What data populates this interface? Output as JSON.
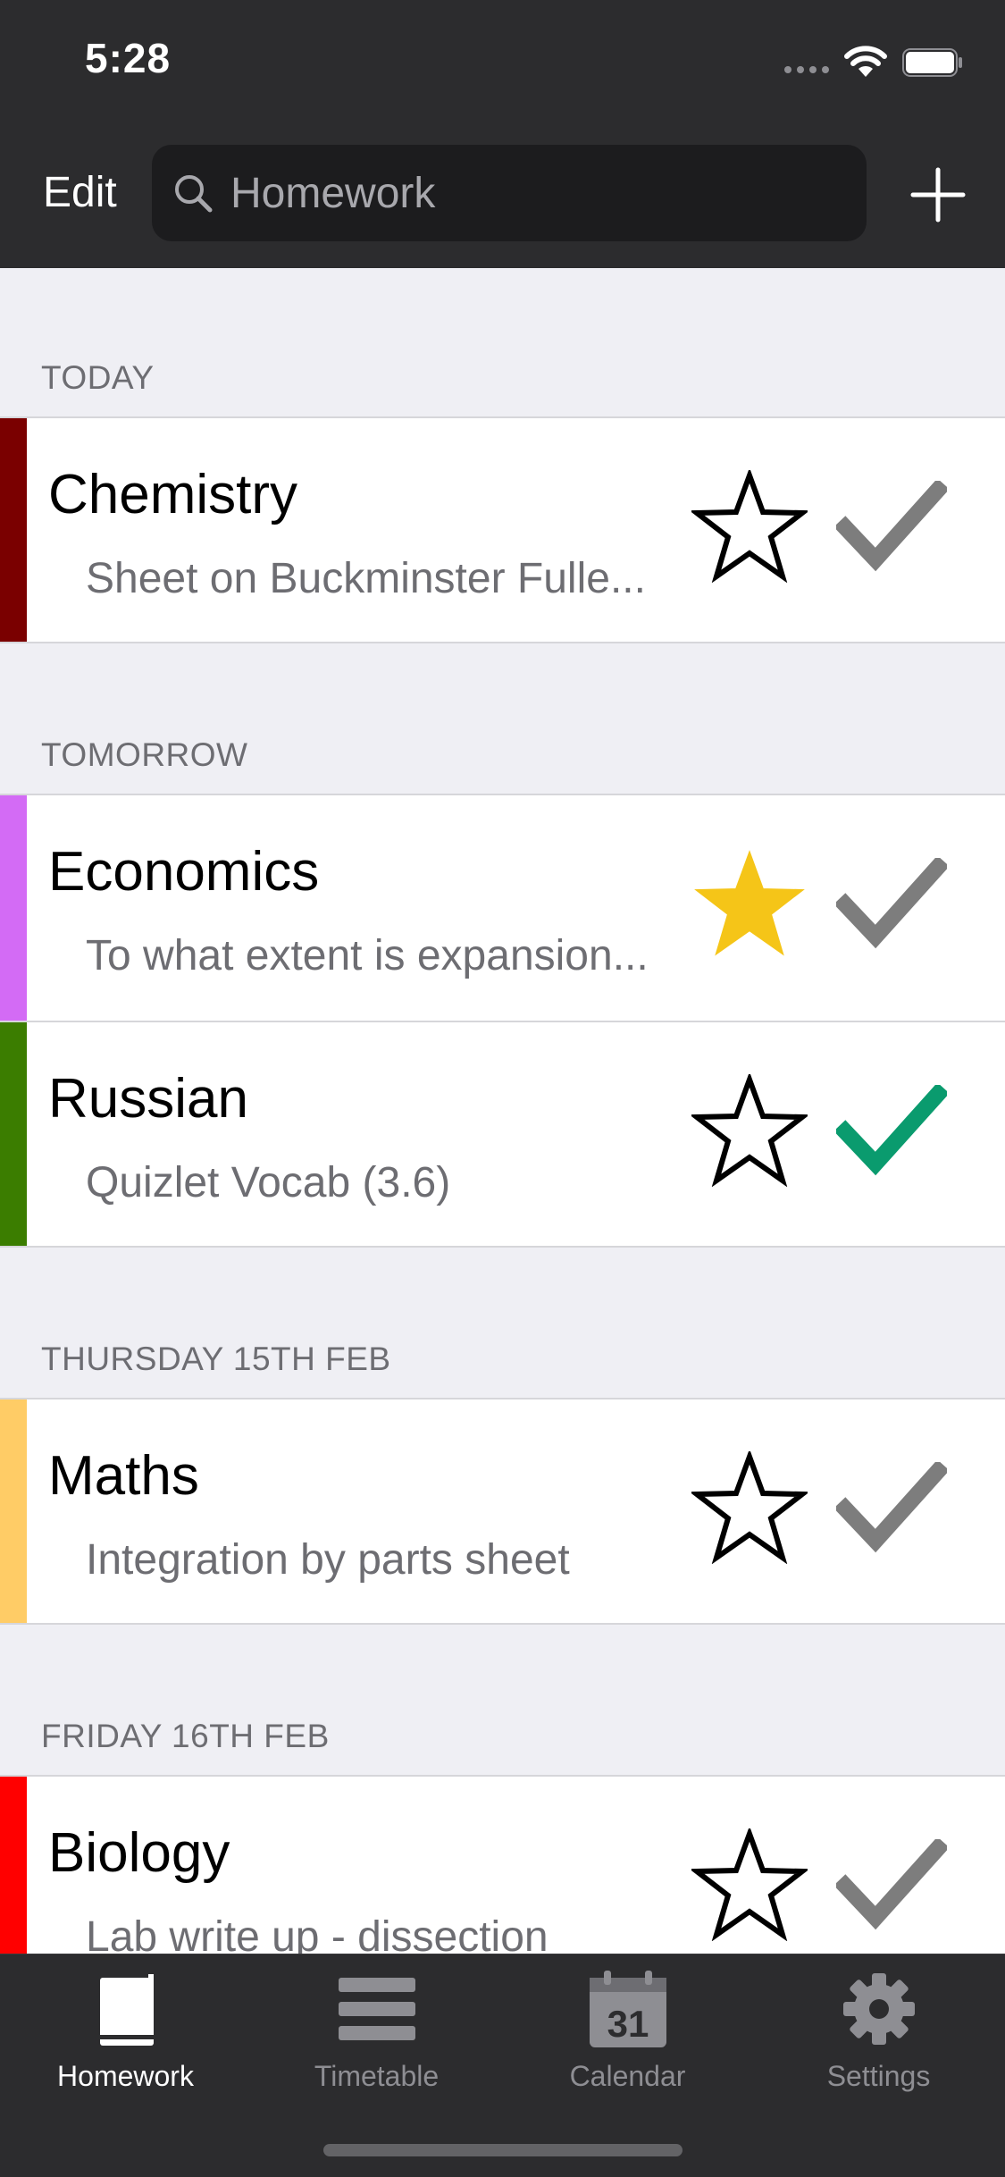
{
  "status_bar": {
    "time": "5:28"
  },
  "nav": {
    "edit_label": "Edit",
    "search_placeholder": "Homework"
  },
  "sections": [
    {
      "header": "TODAY",
      "items": [
        {
          "title": "Chemistry",
          "subtitle": "Sheet on Buckminster Fulle...",
          "color": "#7a0000",
          "starred": false,
          "completed": false
        }
      ]
    },
    {
      "header": "TOMORROW",
      "items": [
        {
          "title": "Economics",
          "subtitle": "To what extent is expansion...",
          "color": "#d36bf5",
          "starred": true,
          "completed": false
        },
        {
          "title": "Russian",
          "subtitle": "Quizlet Vocab (3.6)",
          "color": "#3b7d00",
          "starred": false,
          "completed": true
        }
      ]
    },
    {
      "header": "THURSDAY 15TH FEB",
      "items": [
        {
          "title": "Maths",
          "subtitle": "Integration by parts sheet",
          "color": "#ffcc66",
          "starred": false,
          "completed": false
        }
      ]
    },
    {
      "header": "FRIDAY 16TH FEB",
      "items": [
        {
          "title": "Biology",
          "subtitle": "Lab write up - dissection",
          "color": "#ff0000",
          "starred": false,
          "completed": false
        }
      ]
    }
  ],
  "tabs": [
    {
      "label": "Homework",
      "icon": "book-icon",
      "active": true
    },
    {
      "label": "Timetable",
      "icon": "list-icon",
      "active": false
    },
    {
      "label": "Calendar",
      "icon": "calendar-icon",
      "active": false,
      "calendar_day": "31"
    },
    {
      "label": "Settings",
      "icon": "gear-icon",
      "active": false
    }
  ],
  "colors": {
    "star_filled": "#f5c518",
    "check_done": "#0a9b6e",
    "check_default": "#7d7d7d"
  }
}
